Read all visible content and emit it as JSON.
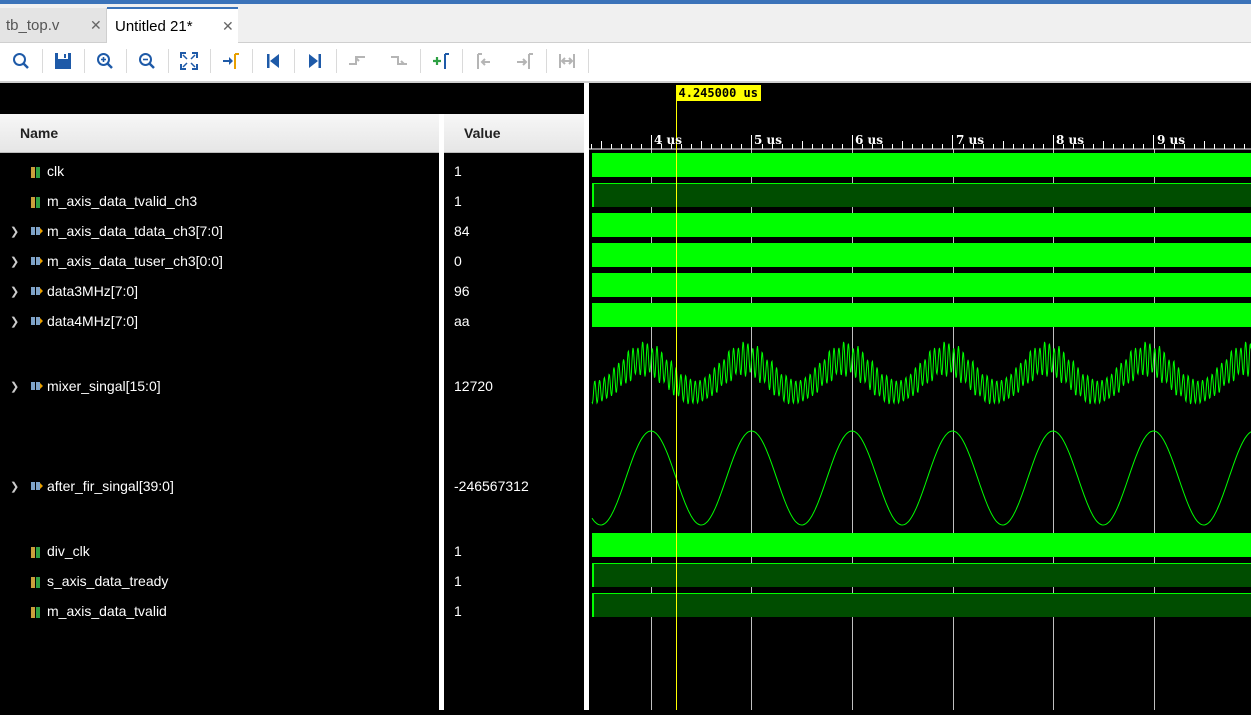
{
  "tabs": [
    {
      "label": "tb_top.v",
      "active": false
    },
    {
      "label": "Untitled 21*",
      "active": true
    }
  ],
  "toolbar": [
    {
      "name": "search-icon"
    },
    {
      "name": "save-icon"
    },
    {
      "name": "zoom-in-icon"
    },
    {
      "name": "zoom-out-icon"
    },
    {
      "name": "zoom-fit-icon"
    },
    {
      "name": "go-to-cursor-icon"
    },
    {
      "name": "go-to-time-zero-icon"
    },
    {
      "name": "go-to-last-time-icon"
    },
    {
      "name": "previous-transition-icon"
    },
    {
      "name": "next-transition-icon"
    },
    {
      "name": "add-marker-icon"
    },
    {
      "name": "previous-marker-icon"
    },
    {
      "name": "next-marker-icon"
    },
    {
      "name": "swap-cursors-icon"
    }
  ],
  "columns": {
    "name": "Name",
    "value": "Value"
  },
  "signals": [
    {
      "name": "clk",
      "value": "1",
      "expandable": false,
      "icon": "single-bit-icon"
    },
    {
      "name": "m_axis_data_tvalid_ch3",
      "value": "1",
      "expandable": false,
      "icon": "single-bit-icon"
    },
    {
      "name": "m_axis_data_tdata_ch3[7:0]",
      "value": "84",
      "expandable": true,
      "icon": "bus-icon"
    },
    {
      "name": "m_axis_data_tuser_ch3[0:0]",
      "value": "0",
      "expandable": true,
      "icon": "bus-icon"
    },
    {
      "name": "data3MHz[7:0]",
      "value": "96",
      "expandable": true,
      "icon": "bus-icon"
    },
    {
      "name": "data4MHz[7:0]",
      "value": "aa",
      "expandable": true,
      "icon": "bus-icon"
    },
    {
      "name": "mixer_singal[15:0]",
      "value": "12720",
      "expandable": true,
      "icon": "bus-icon"
    },
    {
      "name": "after_fir_singal[39:0]",
      "value": "-246567312",
      "expandable": true,
      "icon": "bus-icon"
    },
    {
      "name": "div_clk",
      "value": "1",
      "expandable": false,
      "icon": "single-bit-icon"
    },
    {
      "name": "s_axis_data_tready",
      "value": "1",
      "expandable": false,
      "icon": "single-bit-icon"
    },
    {
      "name": "m_axis_data_tvalid",
      "value": "1",
      "expandable": false,
      "icon": "single-bit-icon"
    }
  ],
  "timeline": {
    "cursor_label": "4.245000 us",
    "cursor_time_us": 4.245,
    "ticks": [
      "4 us",
      "5 us",
      "6 us",
      "7 us",
      "8 us",
      "9 us"
    ],
    "tick_times_us": [
      4,
      5,
      6,
      7,
      8,
      9
    ]
  },
  "colors": {
    "wave": "#00ff00",
    "wave_dark": "#004d00",
    "cursor": "#ffff00",
    "grid": "#ffffff",
    "tab_accent": "#3b73b9"
  }
}
